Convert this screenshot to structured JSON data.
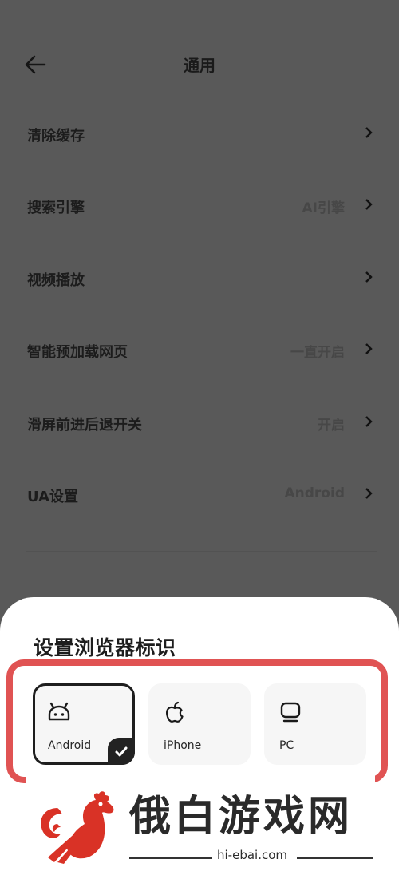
{
  "header": {
    "title": "通用",
    "back_icon": "arrow-left-icon"
  },
  "settings": [
    {
      "label": "清除缓存",
      "value": ""
    },
    {
      "label": "搜索引擎",
      "value": "AI引擎"
    },
    {
      "label": "视频播放",
      "value": ""
    },
    {
      "label": "智能预加载网页",
      "value": "一直开启"
    },
    {
      "label": "滑屏前进后退开关",
      "value": "开启"
    },
    {
      "label": "UA设置",
      "value": "Android"
    }
  ],
  "sheet": {
    "title": "设置浏览器标识",
    "options": [
      {
        "label": "Android",
        "icon": "android-icon",
        "selected": true
      },
      {
        "label": "iPhone",
        "icon": "apple-icon",
        "selected": false
      },
      {
        "label": "PC",
        "icon": "monitor-icon",
        "selected": false
      }
    ]
  },
  "watermark": {
    "title": "俄白游戏网",
    "url": "hi-ebai.com"
  },
  "colors": {
    "overlay": "#595959",
    "highlight": "#e05353",
    "selected_border": "#1e1e1e",
    "brand_red": "#d93226"
  }
}
